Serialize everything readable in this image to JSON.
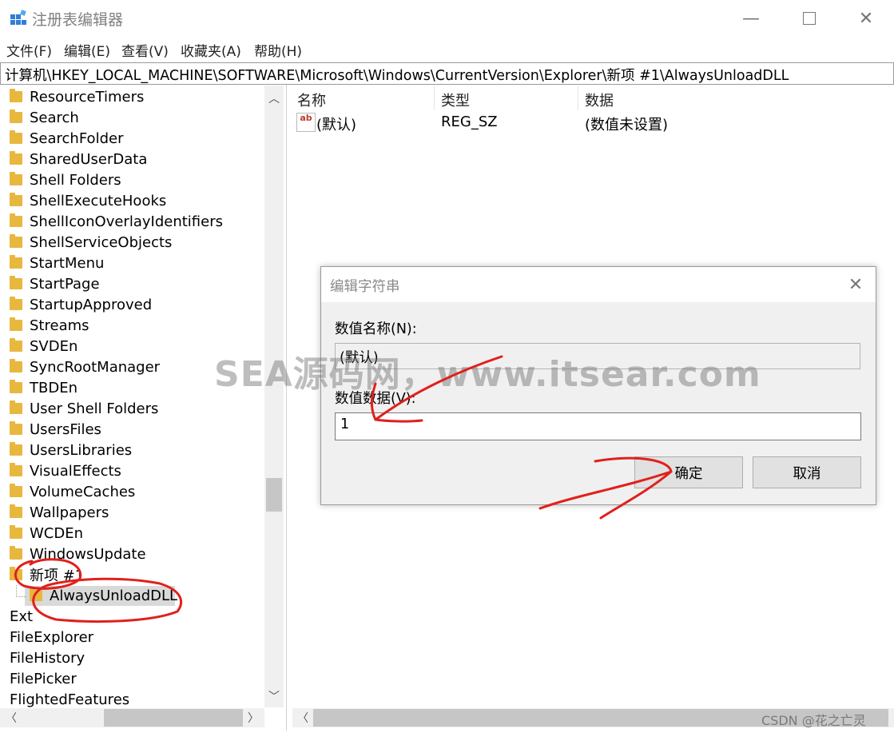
{
  "window": {
    "title": "注册表编辑器"
  },
  "menu": [
    "文件(F)",
    "编辑(E)",
    "查看(V)",
    "收藏夹(A)",
    "帮助(H)"
  ],
  "address": "计算机\\HKEY_LOCAL_MACHINE\\SOFTWARE\\Microsoft\\Windows\\CurrentVersion\\Explorer\\新项 #1\\AlwaysUnloadDLL",
  "tree": {
    "folders": [
      "ResourceTimers",
      "Search",
      "SearchFolder",
      "SharedUserData",
      "Shell Folders",
      "ShellExecuteHooks",
      "ShellIconOverlayIdentifiers",
      "ShellServiceObjects",
      "StartMenu",
      "StartPage",
      "StartupApproved",
      "Streams",
      "SVDEn",
      "SyncRootManager",
      "TBDEn",
      "User Shell Folders",
      "UsersFiles",
      "UsersLibraries",
      "VisualEffects",
      "VolumeCaches",
      "Wallpapers",
      "WCDEn",
      "WindowsUpdate",
      "新项 #1"
    ],
    "selected": "AlwaysUnloadDLL",
    "siblings": [
      "Ext",
      "FileExplorer",
      "FileHistory",
      "FilePicker",
      "FlightedFeatures"
    ]
  },
  "list": {
    "headers": [
      "名称",
      "类型",
      "数据"
    ],
    "row": {
      "name": "(默认)",
      "type": "REG_SZ",
      "data": "(数值未设置)"
    },
    "icon": "ab"
  },
  "dialog": {
    "title": "编辑字符串",
    "name_label": "数值名称(N):",
    "name_value": "(默认)",
    "data_label": "数值数据(V):",
    "data_value": "1",
    "ok": "确定",
    "cancel": "取消"
  },
  "watermarks": {
    "overlay": "SEA源码网，www.itsear.com",
    "corner": "CSDN @花之亡灵"
  },
  "colors": {
    "folder": "#e8b73e",
    "annotation": "#e0201c",
    "selection": "#d9d9d9"
  }
}
